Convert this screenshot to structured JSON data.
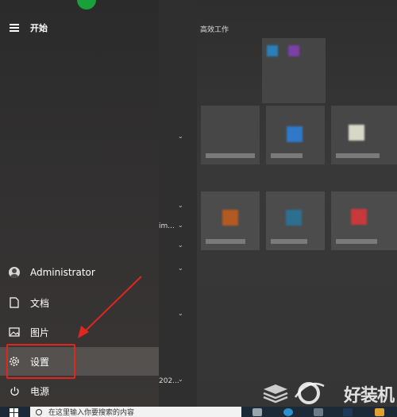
{
  "start_menu": {
    "title": "开始",
    "tiles_section_title": "高效工作",
    "nav": {
      "user": "Administrator",
      "documents": "文档",
      "pictures": "图片",
      "settings": "设置",
      "power": "电源"
    },
    "list_fragments": [
      "im...",
      "202..."
    ]
  },
  "taskbar": {
    "search_placeholder": "在这里输入你要搜索的内容"
  },
  "watermark": {
    "text": "好装机"
  },
  "colors": {
    "highlight": "#e0261f",
    "panel": "#2b2b2b",
    "taskbar": "#1c2a37"
  }
}
